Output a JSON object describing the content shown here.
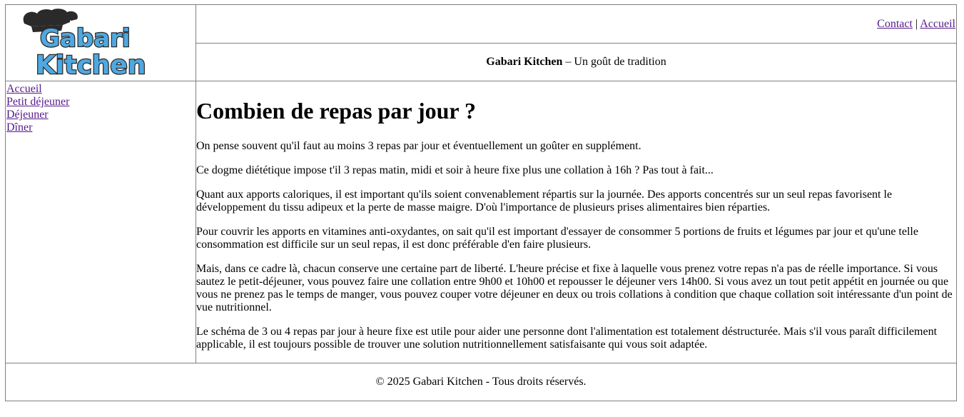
{
  "header": {
    "logo": {
      "line1": "Gabari",
      "line2": "Kitchen",
      "icon": "chef-hat-icon"
    },
    "nav": [
      {
        "label": "Contact"
      },
      {
        "label": "Accueil"
      }
    ],
    "separator": "|",
    "tagline_brand": "Gabari Kitchen",
    "tagline_rest": " – Un goût de tradition"
  },
  "sidebar": {
    "items": [
      {
        "label": "Accueil"
      },
      {
        "label": "Petit déjeuner"
      },
      {
        "label": "Déjeuner"
      },
      {
        "label": "Dîner"
      }
    ]
  },
  "main": {
    "title": "Combien de repas par jour ?",
    "paragraphs": [
      "On pense souvent qu'il faut au moins 3 repas par jour et éventuellement un goûter en supplément.",
      "Ce dogme diététique impose t'il 3 repas matin, midi et soir à heure fixe plus une collation à 16h ? Pas tout à fait...",
      "Quant aux apports caloriques, il est important qu'ils soient convenablement répartis sur la journée. Des apports concentrés sur un seul repas favorisent le développement du tissu adipeux et la perte de masse maigre. D'où l'importance de plusieurs prises alimentaires bien réparties.",
      "Pour couvrir les apports en vitamines anti-oxydantes, on sait qu'il est important d'essayer de consommer 5 portions de fruits et légumes par jour et qu'une telle consommation est difficile sur un seul repas, il est donc préférable d'en faire plusieurs.",
      "Mais, dans ce cadre là, chacun conserve une certaine part de liberté. L'heure précise et fixe à laquelle vous prenez votre repas n'a pas de réelle importance. Si vous sautez le petit-déjeuner, vous pouvez faire une collation entre 9h00 et 10h00 et repousser le déjeuner vers 14h00. Si vous avez un tout petit appétit en journée ou que vous ne prenez pas le temps de manger, vous pouvez couper votre déjeuner en deux ou trois collations à condition que chaque collation soit intéressante d'un point de vue nutritionnel.",
      "Le schéma de 3 ou 4 repas par jour à heure fixe est utile pour aider une personne dont l'alimentation est totalement déstructurée. Mais s'il vous paraît difficilement applicable, il est toujours possible de trouver une solution nutritionnellement satisfaisante qui vous soit adaptée."
    ]
  },
  "footer": {
    "text": "© 2025 Gabari Kitchen - Tous droits réservés."
  },
  "colors": {
    "link": "#551a8b",
    "border": "#808080",
    "logo_blue": "#4fa8e0",
    "logo_dark": "#2a2a2a"
  }
}
